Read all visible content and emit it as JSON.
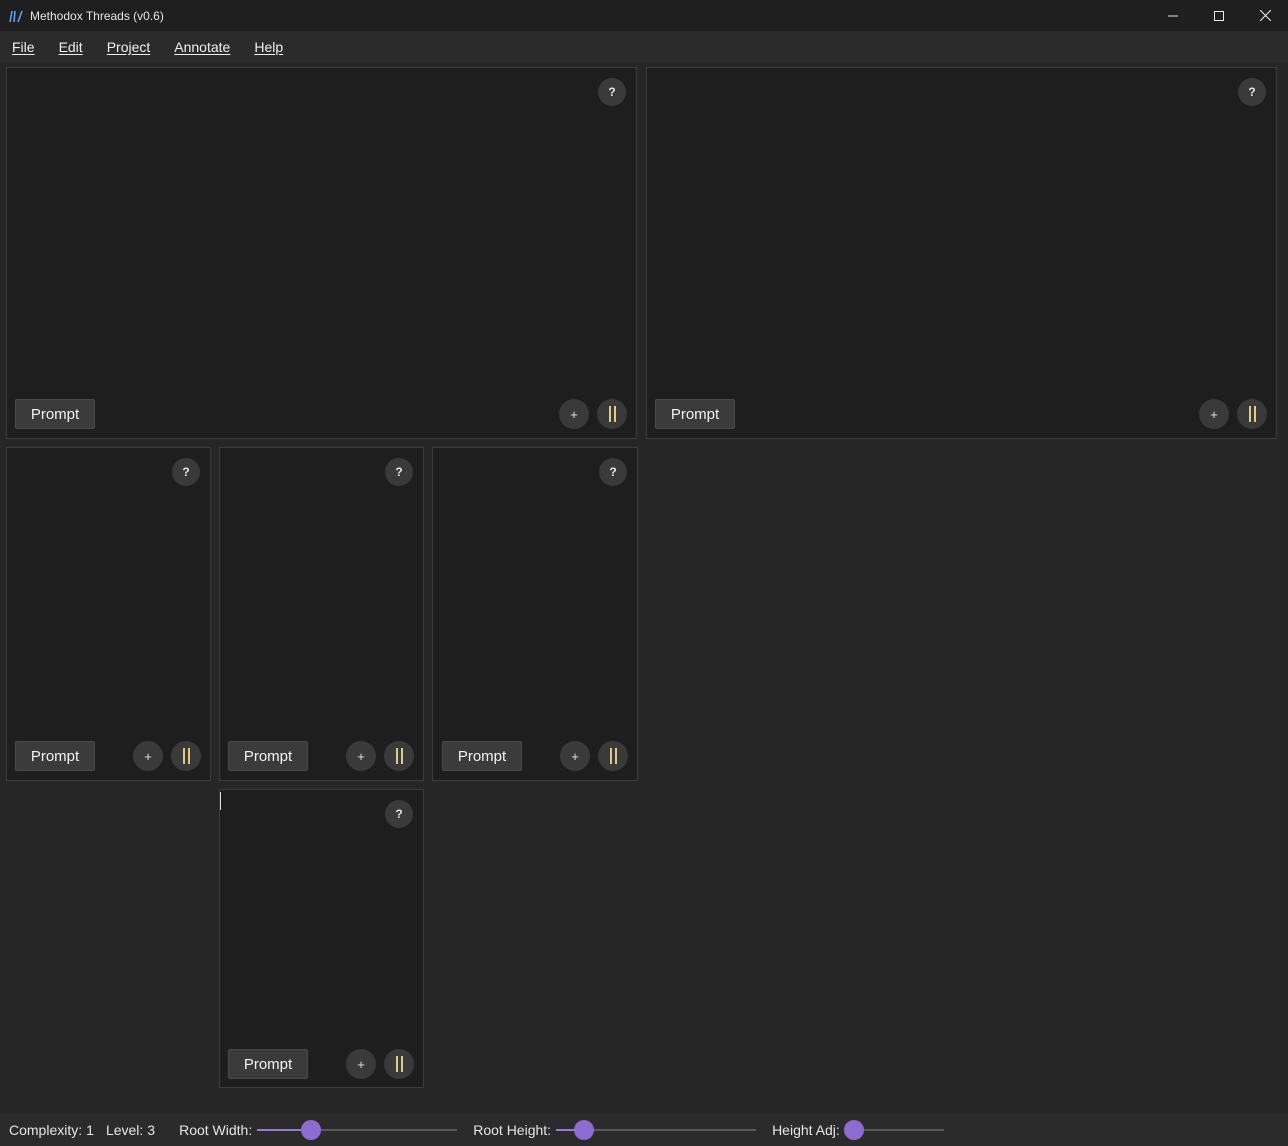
{
  "window": {
    "title": "Methodox Threads (v0.6)",
    "controls": {
      "minimize": "—",
      "maximize": "☐",
      "close": "✕"
    }
  },
  "menu": {
    "items": [
      "File",
      "Edit",
      "Project",
      "Annotate",
      "Help"
    ]
  },
  "panels": {
    "help_label": "?",
    "prompt_label": "Prompt",
    "add_label": "+"
  },
  "status": {
    "complexity_label": "Complexity:",
    "complexity_value": "1",
    "level_label": "Level:",
    "level_value": "3",
    "root_width_label": "Root Width:",
    "root_width_value": 0.27,
    "root_height_label": "Root Height:",
    "root_height_value": 0.14,
    "height_adj_label": "Height Adj:",
    "height_adj_value": 0.0
  },
  "colors": {
    "accent": "#8e6bd1",
    "pause_icon": "#e0c98a",
    "panel_bg": "#1e1e1e",
    "window_bg": "#262626"
  }
}
